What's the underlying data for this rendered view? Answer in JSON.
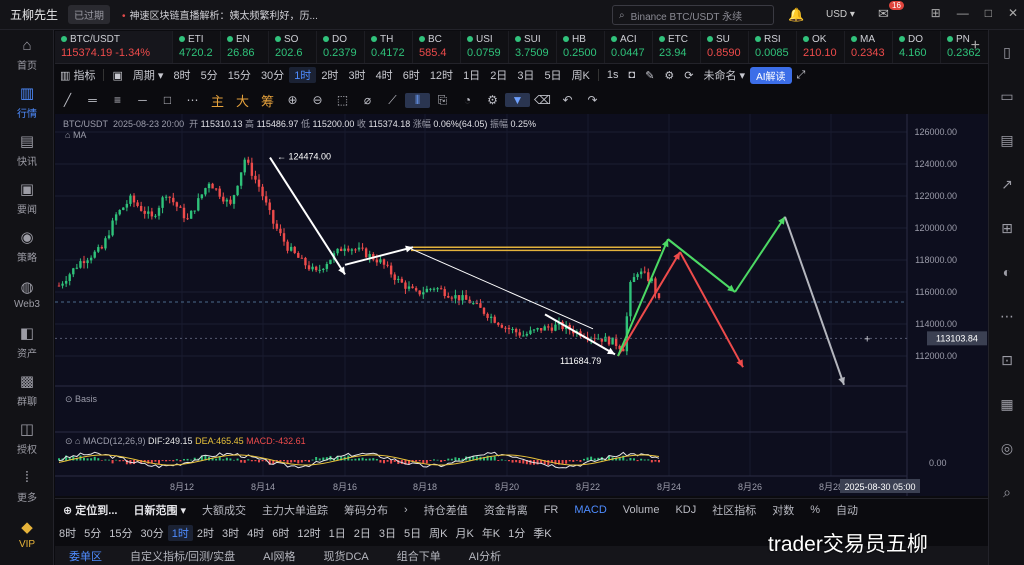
{
  "topbar": {
    "app_name": "五柳先生",
    "expired": "已过期",
    "news": "神速区块链直播解析：姨太频繁利好，历...",
    "search_placeholder": "Binance BTC/USDT 永续",
    "currency": "USD",
    "mail_badge": "16"
  },
  "leftnav": [
    {
      "label": "首页",
      "icon": "home-icon",
      "glyph": "⌂"
    },
    {
      "label": "行情",
      "icon": "market-icon",
      "glyph": "▥"
    },
    {
      "label": "快讯",
      "icon": "news-icon",
      "glyph": "▤"
    },
    {
      "label": "要闻",
      "icon": "headline-icon",
      "glyph": "▣"
    },
    {
      "label": "策略",
      "icon": "strategy-icon",
      "glyph": "◉"
    },
    {
      "label": "Web3",
      "icon": "web3-icon",
      "glyph": "◍"
    },
    {
      "label": "资产",
      "icon": "asset-icon",
      "glyph": "◧"
    },
    {
      "label": "群聊",
      "icon": "chat-icon",
      "glyph": "▩"
    },
    {
      "label": "授权",
      "icon": "auth-icon",
      "glyph": "◫"
    },
    {
      "label": "更多",
      "icon": "more-icon",
      "glyph": "⁞"
    },
    {
      "label": "VIP",
      "icon": "vip-icon",
      "glyph": "◆"
    }
  ],
  "rightnav": [
    "▯",
    "▭",
    "▤",
    "↗",
    "⊞",
    "◐",
    "⋯",
    "⊡",
    "▦",
    "◎",
    "⌕"
  ],
  "tickers": [
    {
      "sym": "BTC/USDT",
      "price": "115374.19",
      "chg": "-1.34%",
      "dir": "dn"
    },
    {
      "sym": "ETI",
      "price": "4720.2",
      "dir": "up"
    },
    {
      "sym": "EN",
      "price": "26.86",
      "dir": "up"
    },
    {
      "sym": "SO",
      "price": "202.6",
      "dir": "up"
    },
    {
      "sym": "DO",
      "price": "0.2379",
      "dir": "up"
    },
    {
      "sym": "TH",
      "price": "0.4172",
      "dir": "up"
    },
    {
      "sym": "BC",
      "price": "585.4",
      "dir": "dn"
    },
    {
      "sym": "USI",
      "price": "0.0759",
      "dir": "up"
    },
    {
      "sym": "SUI",
      "price": "3.7509",
      "dir": "up"
    },
    {
      "sym": "HB",
      "price": "0.2500",
      "dir": "up"
    },
    {
      "sym": "ACI",
      "price": "0.0447",
      "dir": "up"
    },
    {
      "sym": "ETC",
      "price": "23.94",
      "dir": "up"
    },
    {
      "sym": "SU",
      "price": "0.8590",
      "dir": "dn"
    },
    {
      "sym": "RSI",
      "price": "0.0085",
      "dir": "up"
    },
    {
      "sym": "OK",
      "price": "210.10",
      "dir": "dn"
    },
    {
      "sym": "MA",
      "price": "0.2343",
      "dir": "dn"
    },
    {
      "sym": "DO",
      "price": "4.160",
      "dir": "up"
    },
    {
      "sym": "PN",
      "price": "0.2362",
      "dir": "up"
    }
  ],
  "toolbar": {
    "indicators": "指标",
    "period": "周期",
    "intervals": [
      "8时",
      "5分",
      "15分",
      "30分",
      "1时",
      "2时",
      "3时",
      "4时",
      "6时",
      "12时",
      "1日",
      "2日",
      "3日",
      "5日",
      "周K"
    ],
    "selected": "1时",
    "right_items": [
      "1s",
      "未命名",
      "AI解读"
    ]
  },
  "drawtools": [
    "╱",
    "═",
    "≡",
    "─",
    "□",
    "⋯",
    "主",
    "大",
    "筹",
    "⊕",
    "⊖",
    "⬚",
    "⌀",
    "⟋",
    "⫴",
    "⎘",
    "◔",
    "⚙",
    "▼",
    "⌫",
    "↶",
    "↷"
  ],
  "chart_info": {
    "pair": "BTC/USDT",
    "time": "2025-08-23 20:00",
    "open_label": "开",
    "open": "115310.13",
    "high_label": "高",
    "high": "115486.97",
    "low_label": "低",
    "low": "115200.00",
    "close_label": "收",
    "close": "115374.18",
    "chg_label": "涨幅",
    "chg": "0.06%(64.05)",
    "amp_label": "振幅",
    "amp": "0.25%",
    "ma": "MA",
    "basis": "Basis",
    "macd_label": "MACD(12,26,9)",
    "dif": "DIF:249.15",
    "dea": "DEA:465.45",
    "macd": "MACD:-432.61"
  },
  "chart_data": {
    "type": "candlestick",
    "y_ticks": [
      112000,
      114000,
      116000,
      118000,
      120000,
      122000,
      124000,
      126000
    ],
    "y_tick_labels": [
      "112000.00",
      "114000.00",
      "116000.00",
      "118000.00",
      "120000.00",
      "122000.00",
      "124000.00",
      "126000.00"
    ],
    "x_ticks": [
      "8月12",
      "8月14",
      "8月16",
      "8月18",
      "8月20",
      "8月22",
      "8月24",
      "8月26",
      "8月28"
    ],
    "crosshair_price": "113103.84",
    "crosshair_time": "2025-08-30 05:00",
    "macd_zero": "0.00",
    "annotations": {
      "high_label": "124474.00",
      "low_label": "111684.79"
    },
    "trend": [
      [
        0,
        116400
      ],
      [
        6,
        117900
      ],
      [
        12,
        118700
      ],
      [
        16,
        120800
      ],
      [
        20,
        121800
      ],
      [
        26,
        120600
      ],
      [
        30,
        122200
      ],
      [
        36,
        120500
      ],
      [
        42,
        122900
      ],
      [
        48,
        121400
      ],
      [
        52,
        124300
      ],
      [
        56,
        122600
      ],
      [
        60,
        120300
      ],
      [
        64,
        118800
      ],
      [
        68,
        117900
      ],
      [
        72,
        117200
      ],
      [
        76,
        118100
      ],
      [
        80,
        118900
      ],
      [
        85,
        118500
      ],
      [
        90,
        117900
      ],
      [
        95,
        116700
      ],
      [
        100,
        115900
      ],
      [
        105,
        116300
      ],
      [
        110,
        115800
      ],
      [
        115,
        115400
      ],
      [
        120,
        114600
      ],
      [
        125,
        113800
      ],
      [
        130,
        113300
      ],
      [
        135,
        113700
      ],
      [
        140,
        113900
      ],
      [
        145,
        113500
      ],
      [
        150,
        113200
      ],
      [
        155,
        112900
      ],
      [
        158,
        112500
      ],
      [
        160,
        116400
      ],
      [
        162,
        117300
      ],
      [
        166,
        116700
      ],
      [
        168,
        115400
      ]
    ]
  },
  "tabs": {
    "left": [
      "定位到...",
      "日新范围"
    ],
    "items": [
      "大额成交",
      "主力大单追踪",
      "筹码分布",
      "持仓差值",
      "资金背离",
      "FR",
      "MACD",
      "Volume",
      "KDJ",
      "社区指标",
      "对数",
      "%",
      "自动"
    ],
    "selected": "MACD"
  },
  "periods": [
    "8时",
    "5分",
    "15分",
    "30分",
    "1时",
    "2时",
    "3时",
    "4时",
    "6时",
    "12时",
    "1日",
    "2日",
    "3日",
    "5日",
    "周K",
    "月K",
    "年K",
    "1分",
    "季K"
  ],
  "periods_selected": "1时",
  "footer": [
    "委单区",
    "自定义指标/回测/实盘",
    "AI网格",
    "现货DCA",
    "组合下单",
    "AI分析"
  ],
  "watermark": "trader交易员五柳"
}
